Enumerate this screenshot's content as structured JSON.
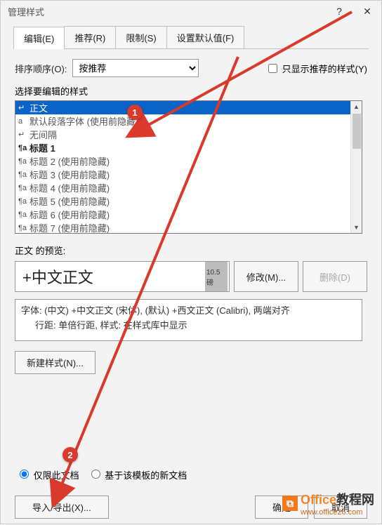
{
  "title": "管理样式",
  "tabs": [
    {
      "label": "编辑(E)"
    },
    {
      "label": "推荐(R)"
    },
    {
      "label": "限制(S)"
    },
    {
      "label": "设置默认值(F)"
    }
  ],
  "sort": {
    "label": "排序顺序(O):",
    "value": "按推荐"
  },
  "show_recommended": {
    "label": "只显示推荐的样式(Y)",
    "checked": false
  },
  "select_label": "选择要编辑的样式",
  "styles": [
    {
      "mark": "↵",
      "name": "正文",
      "selected": true
    },
    {
      "mark": "a",
      "name": "默认段落字体 (使用前隐藏)"
    },
    {
      "mark": "↵",
      "name": "无间隔"
    },
    {
      "mark": "¶a",
      "name": "标题 1"
    },
    {
      "mark": "¶a",
      "name": "标题 2  (使用前隐藏)"
    },
    {
      "mark": "¶a",
      "name": "标题 3  (使用前隐藏)"
    },
    {
      "mark": "¶a",
      "name": "标题 4  (使用前隐藏)"
    },
    {
      "mark": "¶a",
      "name": "标题 5  (使用前隐藏)"
    },
    {
      "mark": "¶a",
      "name": "标题 6  (使用前隐藏)"
    },
    {
      "mark": "¶a",
      "name": "标题 7  (使用前隐藏)"
    }
  ],
  "preview": {
    "label": "正文 的预览:",
    "text": "+中文正文",
    "size": "10.5 磅"
  },
  "buttons": {
    "modify": "修改(M)...",
    "delete": "删除(D)",
    "new_style": "新建样式(N)...",
    "import_export": "导入/导出(X)...",
    "ok": "确定",
    "cancel": "取消"
  },
  "description": {
    "line1": "字体: (中文) +中文正文 (宋体), (默认) +西文正文 (Calibri), 两端对齐",
    "line2": "行距: 单倍行距, 样式: 在样式库中显示"
  },
  "radios": {
    "doc_only": "仅限此文档",
    "template": "基于该模板的新文档"
  },
  "callouts": {
    "c1": "1",
    "c2": "2"
  },
  "watermark": {
    "brand": "Office",
    "suffix": "教程网",
    "url": "www.office26.com"
  }
}
